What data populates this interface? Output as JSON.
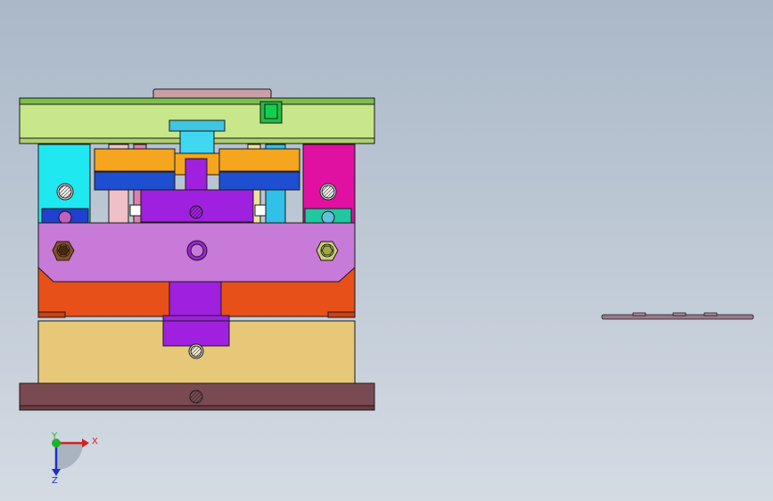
{
  "viewport": {
    "background_top": "#aebccd",
    "background_bottom": "#d2dae3"
  },
  "triad": {
    "x_label": "X",
    "y_label": "Y",
    "z_label": "Z",
    "x_color": "#d42020",
    "y_color": "#20b030",
    "z_color": "#2030c0"
  },
  "colors": {
    "top_clamp_plate": "#c8e68a",
    "top_rail": "#7cc04a",
    "sprue_ring": "#c9a0a8",
    "locating_ring": "#3fc6e0",
    "stripper_plate": "#f5a51e",
    "runner_plate": "#1e4fd0",
    "guide_pillar_left": "#20e8f0",
    "guide_pillar_right": "#e010a0",
    "sprue_bushing": "#a020e0",
    "clamp_bar": "#c87ad8",
    "moving_plate": "#e8501a",
    "support_plate": "#e6c878",
    "bottom_clamp_plate": "#7a4a52",
    "side_block_left": "#2040d0",
    "side_block_right": "#20c8a0",
    "ejector_guide": "#e080b0",
    "hex_bolt_left": "#8a5020",
    "hex_bolt_right": "#c8d070",
    "small_part": "#9a7a8a"
  }
}
